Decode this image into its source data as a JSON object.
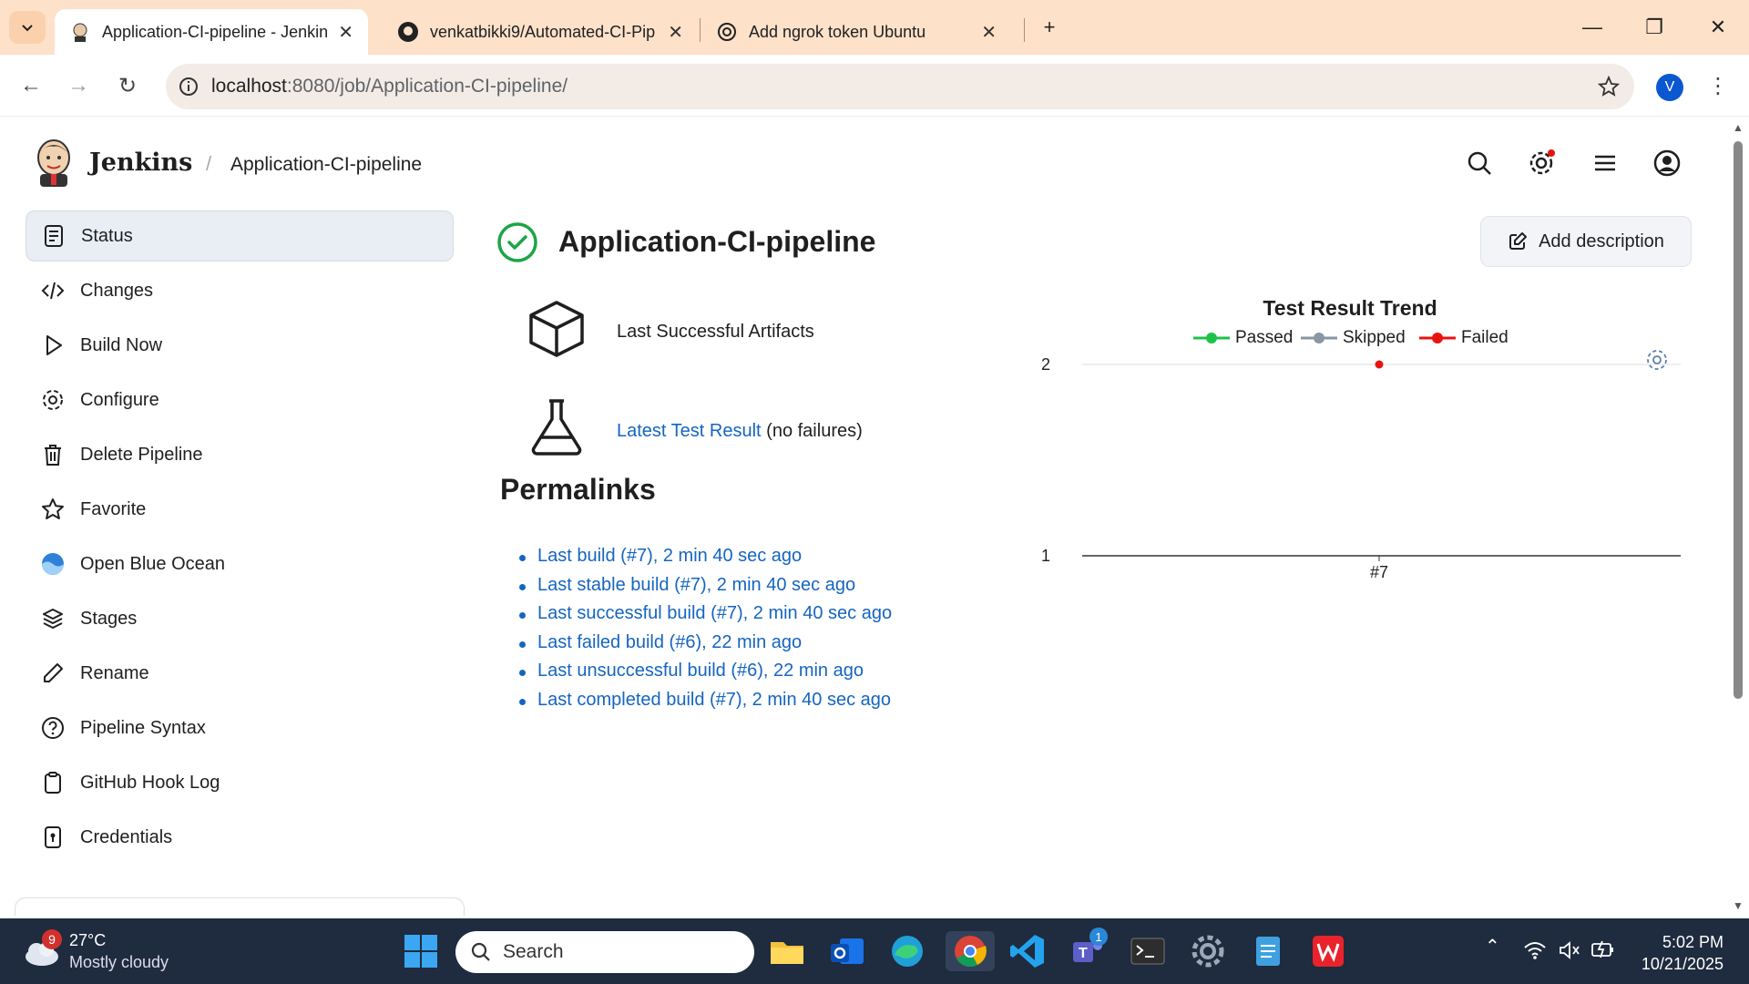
{
  "browser": {
    "tabs": [
      {
        "title": "Application-CI-pipeline - Jenkin",
        "active": true
      },
      {
        "title": "venkatbikki9/Automated-CI-Pip",
        "active": false
      },
      {
        "title": "Add ngrok token Ubuntu",
        "active": false
      }
    ],
    "url_host": "localhost",
    "url_rest": ":8080/job/Application-CI-pipeline/",
    "profile_initial": "V"
  },
  "jenkins": {
    "brand": "Jenkins",
    "breadcrumb": "Application-CI-pipeline",
    "accent": "#1565c0",
    "success_color": "#1ea446"
  },
  "sidebar": {
    "items": [
      {
        "label": "Status",
        "icon": "document-icon",
        "active": true
      },
      {
        "label": "Changes",
        "icon": "code-icon"
      },
      {
        "label": "Build Now",
        "icon": "play-icon"
      },
      {
        "label": "Configure",
        "icon": "gear-icon"
      },
      {
        "label": "Delete Pipeline",
        "icon": "trash-icon"
      },
      {
        "label": "Favorite",
        "icon": "star-icon"
      },
      {
        "label": "Open Blue Ocean",
        "icon": "blue-ocean-icon"
      },
      {
        "label": "Stages",
        "icon": "layers-icon"
      },
      {
        "label": "Rename",
        "icon": "pencil-icon"
      },
      {
        "label": "Pipeline Syntax",
        "icon": "help-icon"
      },
      {
        "label": "GitHub Hook Log",
        "icon": "clipboard-icon"
      },
      {
        "label": "Credentials",
        "icon": "credentials-icon"
      }
    ]
  },
  "main": {
    "title": "Application-CI-pipeline",
    "add_description": "Add description",
    "artifacts_link": "Last Successful Artifacts",
    "test_result_link": "Latest Test Result",
    "test_result_suffix": " (no failures)",
    "permalinks_title": "Permalinks",
    "permalinks": [
      "Last build (#7), 2 min 40 sec ago",
      "Last stable build (#7), 2 min 40 sec ago",
      "Last successful build (#7), 2 min 40 sec ago",
      "Last failed build (#6), 22 min ago",
      "Last unsuccessful build (#6), 22 min ago",
      "Last completed build (#7), 2 min 40 sec ago"
    ]
  },
  "chart_data": {
    "type": "line",
    "title": "Test Result Trend",
    "x": [
      "#7"
    ],
    "ylim": [
      1,
      2
    ],
    "yticks": [
      "2",
      "1"
    ],
    "series": [
      {
        "name": "Passed",
        "color": "#1ec24a",
        "values": [
          null
        ]
      },
      {
        "name": "Skipped",
        "color": "#8a96a3",
        "values": [
          null
        ]
      },
      {
        "name": "Failed",
        "color": "#e8130f",
        "values": [
          2
        ]
      }
    ],
    "legend": "top"
  },
  "taskbar": {
    "weather_temp": "27°C",
    "weather_desc": "Mostly cloudy",
    "weather_badge": "9",
    "search_placeholder": "Search",
    "time": "5:02 PM",
    "date": "10/21/2025",
    "teams_badge": "1"
  }
}
